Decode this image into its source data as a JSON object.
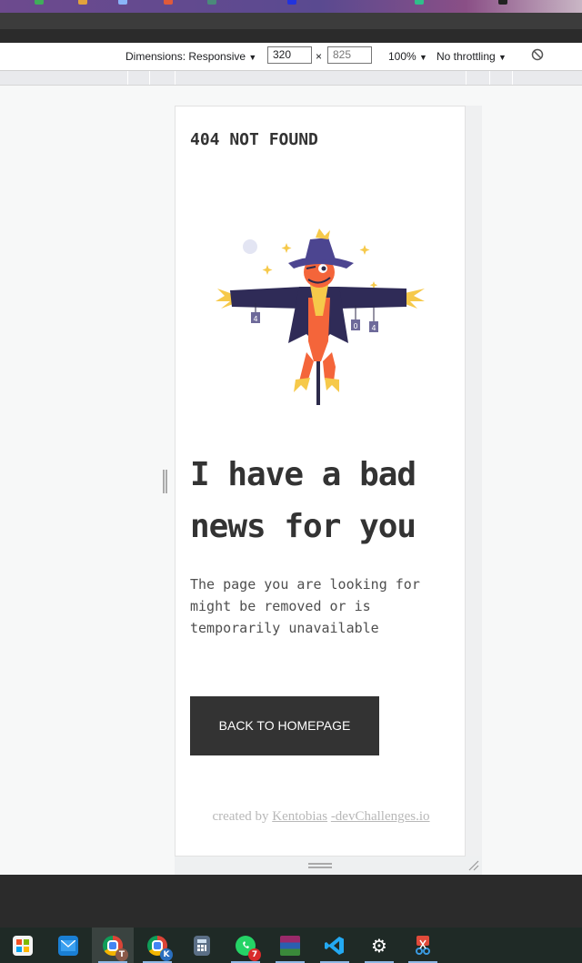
{
  "devtools": {
    "dimensions_label": "Dimensions: Responsive",
    "width_value": "320",
    "times_sign": "×",
    "height_placeholder": "825",
    "zoom": "100%",
    "throttling": "No throttling",
    "dropdown_arrow": "▼"
  },
  "page": {
    "title": "404 NOT FOUND",
    "headline_line1": "I have a bad",
    "headline_line2": "news for you",
    "description": "The page you are looking for might be removed or is temporarily unavailable",
    "button_label": "BACK TO HOMEPAGE",
    "credit_prefix": "created by",
    "credit_author": "Kentobias",
    "credit_site": "-devChallenges.io"
  },
  "taskbar": {
    "items": [
      "microsoft-store",
      "mail",
      "chrome-profile-t",
      "chrome-profile-k",
      "calculator",
      "whatsapp",
      "winrar",
      "vscode",
      "settings",
      "snipping-tool"
    ],
    "chrome_t_letter": "T",
    "chrome_k_letter": "K",
    "whatsapp_badge": "7"
  },
  "colors": {
    "button_bg": "#333333",
    "text_dark": "#333333",
    "credit": "#b8b8b8",
    "taskbar": "#1f2a26"
  }
}
